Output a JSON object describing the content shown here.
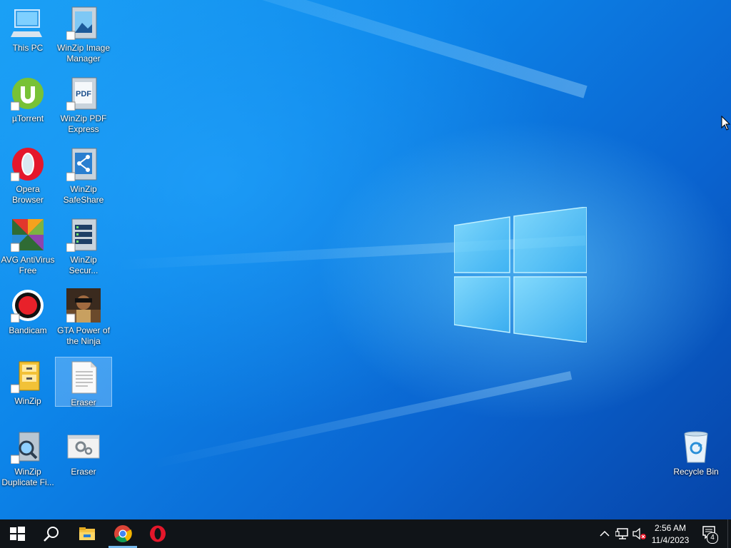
{
  "desktop": {
    "icons": [
      {
        "label": "This PC",
        "icon": "this-pc-icon"
      },
      {
        "label": "WinZip Image Manager",
        "icon": "winzip-image-manager-icon"
      },
      {
        "label": "µTorrent",
        "icon": "utorrent-icon"
      },
      {
        "label": "WinZip PDF Express",
        "icon": "winzip-pdf-express-icon"
      },
      {
        "label": "Opera Browser",
        "icon": "opera-icon"
      },
      {
        "label": "WinZip SafeShare",
        "icon": "winzip-safeshare-icon"
      },
      {
        "label": "AVG AntiVirus Free",
        "icon": "avg-antivirus-icon"
      },
      {
        "label": "WinZip Secur...",
        "icon": "winzip-secure-backup-icon"
      },
      {
        "label": "Bandicam",
        "icon": "bandicam-icon"
      },
      {
        "label": "GTA Power of the Ninja",
        "icon": "gta-icon"
      },
      {
        "label": "WinZip",
        "icon": "winzip-icon"
      },
      {
        "label": "Eraser",
        "icon": "text-document-icon"
      },
      {
        "label": "WinZip Duplicate Fi...",
        "icon": "winzip-duplicate-finder-icon"
      },
      {
        "label": "Eraser",
        "icon": "eraser-app-icon"
      },
      {
        "label": "Recycle Bin",
        "icon": "recycle-bin-icon"
      }
    ]
  },
  "taskbar": {
    "apps": [
      "start-icon",
      "search-icon",
      "file-explorer-icon",
      "chrome-icon",
      "opera-icon"
    ],
    "clock": {
      "time": "2:56 AM",
      "date": "11/4/2023"
    },
    "notifications_count": "4"
  },
  "colors": {
    "taskbar_bg": "#101418",
    "desktop_accent": "#0a6fd6",
    "selection": "#aad2ff"
  }
}
